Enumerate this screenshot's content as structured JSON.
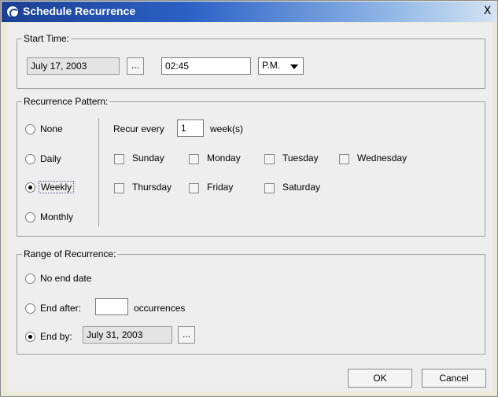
{
  "window": {
    "title": "Schedule Recurrence",
    "close_glyph": "X"
  },
  "start_time": {
    "legend": "Start Time:",
    "date_value": "July 17, 2003",
    "date_button": "...",
    "time_value": "02:45",
    "ampm_value": "P.M."
  },
  "pattern": {
    "legend": "Recurrence Pattern:",
    "options": [
      "None",
      "Daily",
      "Weekly",
      "Monthly"
    ],
    "selected": "Weekly",
    "recur_label": "Recur every",
    "recur_value": "1",
    "recur_unit": "week(s)",
    "days_row1": [
      "Sunday",
      "Monday",
      "Tuesday",
      "Wednesday"
    ],
    "days_row2": [
      "Thursday",
      "Friday",
      "Saturday"
    ]
  },
  "range": {
    "legend": "Range of Recurrence:",
    "no_end": "No end date",
    "end_after": "End after:",
    "end_after_value": "",
    "occurrences": "occurrences",
    "end_by": "End by:",
    "end_by_value": "July 31, 2003",
    "end_by_button": "...",
    "selected": "End by"
  },
  "buttons": {
    "ok": "OK",
    "cancel": "Cancel"
  }
}
